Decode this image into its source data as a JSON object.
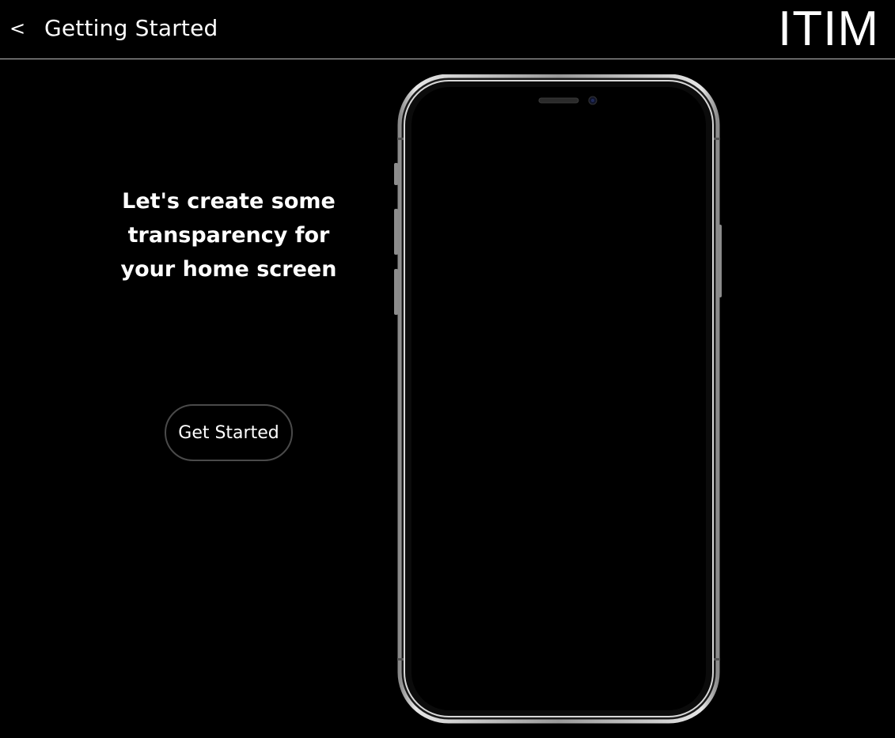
{
  "header": {
    "back_label": "<",
    "title": "Getting Started",
    "brand": "ITIM"
  },
  "main": {
    "headline": "Let's create some transparency for your home screen",
    "cta_label": "Get Started"
  },
  "colors": {
    "background": "#000000",
    "text": "#ffffff",
    "divider": "#bfbfbf",
    "button_border": "#4a4a4a"
  },
  "icons": {
    "back": "chevron-left-icon"
  }
}
